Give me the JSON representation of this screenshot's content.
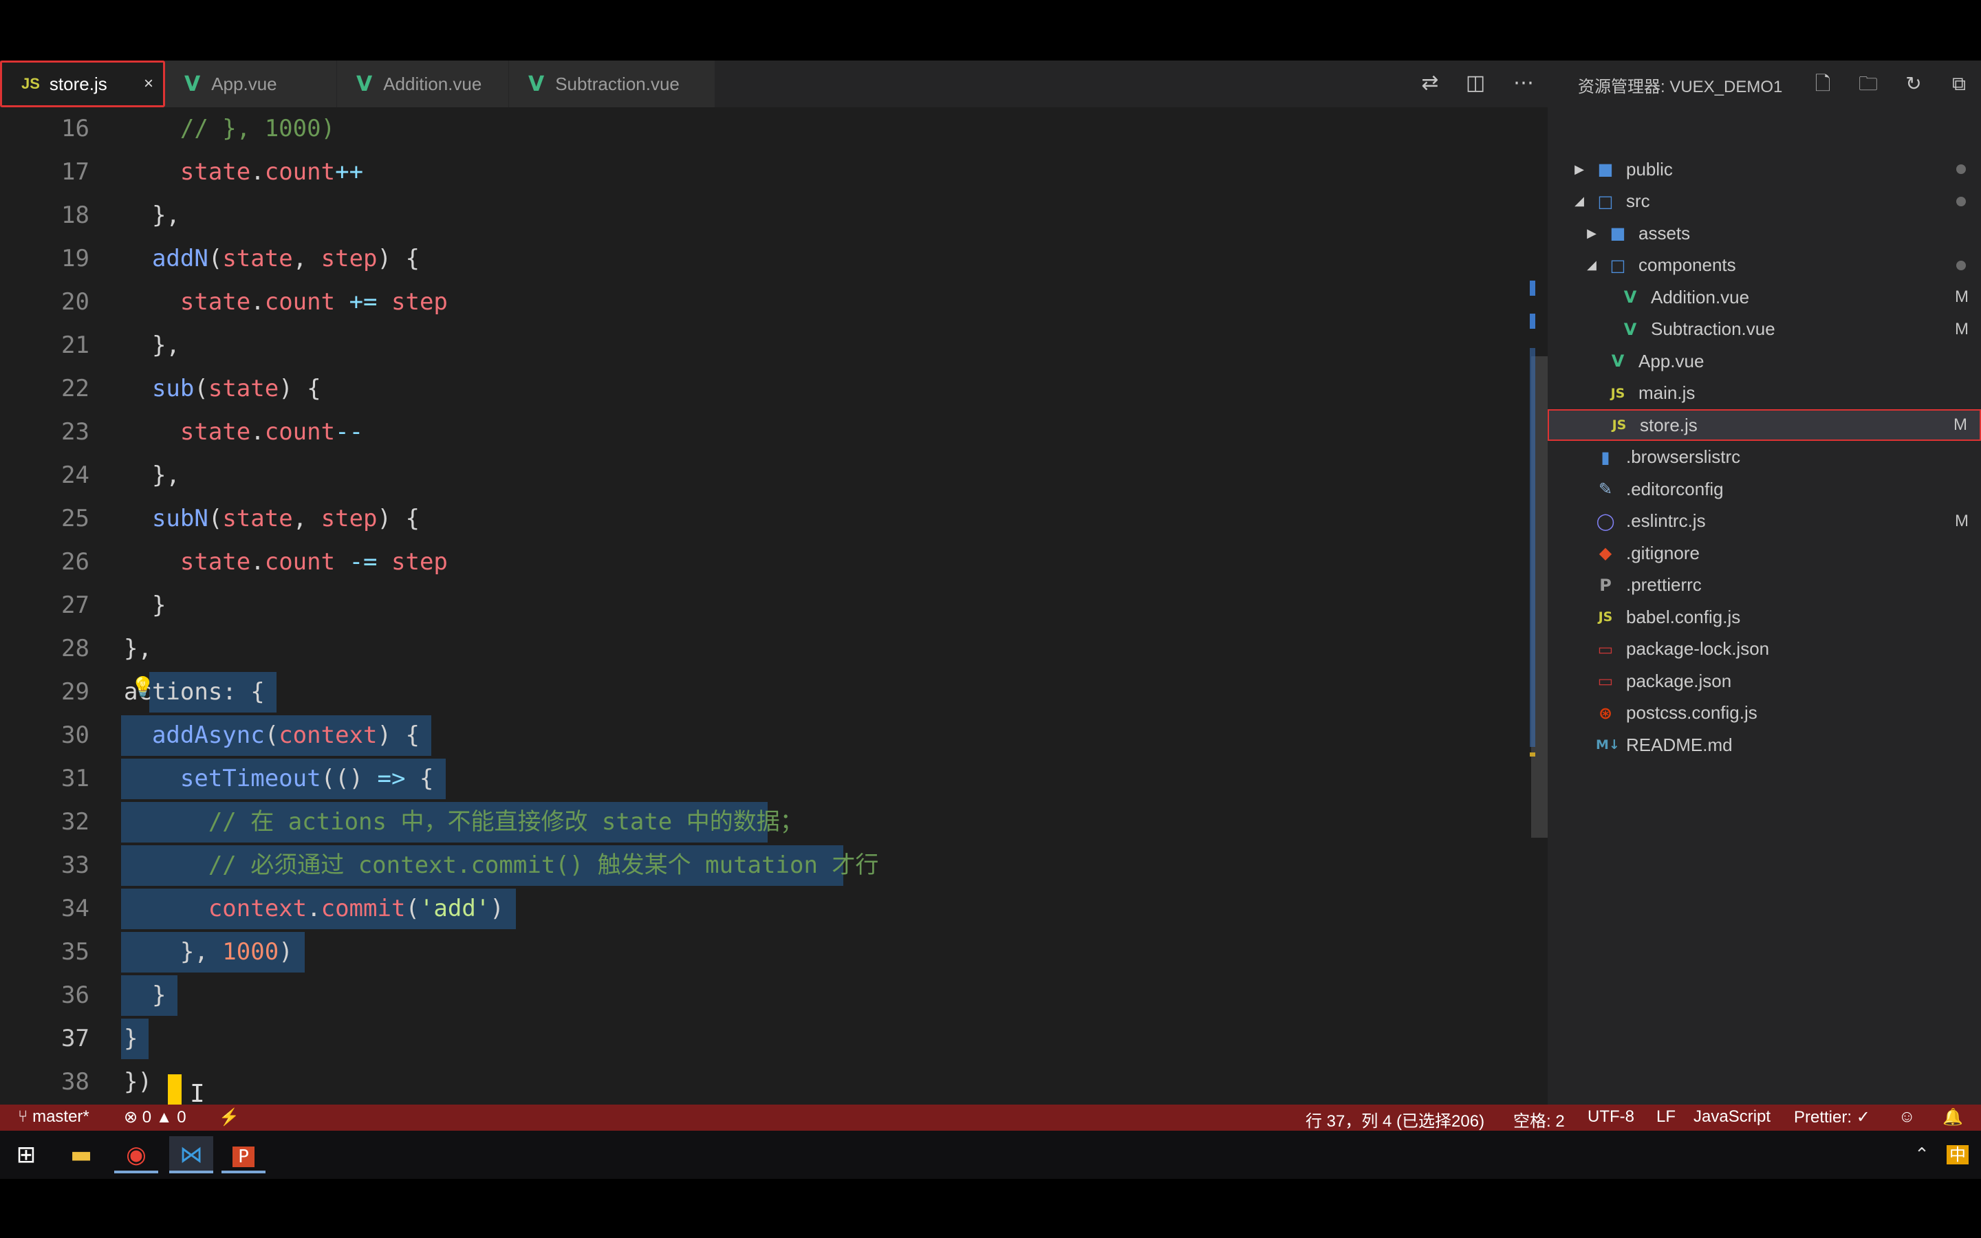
{
  "tabs": [
    {
      "icon": "JS",
      "label": "store.js",
      "close": "×"
    },
    {
      "icon": "V",
      "label": "App.vue"
    },
    {
      "icon": "V",
      "label": "Addition.vue"
    },
    {
      "icon": "V",
      "label": "Subtraction.vue"
    }
  ],
  "editor": {
    "line_numbers": [
      "16",
      "17",
      "18",
      "19",
      "20",
      "21",
      "22",
      "23",
      "24",
      "25",
      "26",
      "27",
      "28",
      "29",
      "30",
      "31",
      "32",
      "33",
      "34",
      "35",
      "36",
      "37",
      "38"
    ],
    "lines": [
      "    // }, 1000)",
      "    state.count++",
      "  },",
      "  addN(state, step) {",
      "    state.count += step",
      "  },",
      "  sub(state) {",
      "    state.count--",
      "  },",
      "  subN(state, step) {",
      "    state.count -= step",
      "  }",
      "},",
      "actions: {",
      "  addAsync(context) {",
      "    setTimeout(() => {",
      "      // 在 actions 中，不能直接修改 state 中的数据；",
      "      // 必须通过 context.commit() 触发某个 mutation 才行",
      "      context.commit('add')",
      "    }, 1000)",
      "  }",
      "}",
      "})"
    ],
    "cursor_line": "37",
    "bulb_icon": "💡"
  },
  "sidebar": {
    "title": "资源管理器: VUEX_DEMO1",
    "items": [
      {
        "name": "public",
        "type": "folder",
        "status": "●"
      },
      {
        "name": "src",
        "type": "folder-open",
        "status": "●"
      },
      {
        "name": "assets",
        "type": "folder"
      },
      {
        "name": "components",
        "type": "folder-open",
        "status": "●"
      },
      {
        "name": "Addition.vue",
        "type": "vue",
        "status": "M"
      },
      {
        "name": "Subtraction.vue",
        "type": "vue",
        "status": "M"
      },
      {
        "name": "App.vue",
        "type": "vue"
      },
      {
        "name": "main.js",
        "type": "js"
      },
      {
        "name": "store.js",
        "type": "js",
        "status": "M",
        "selected": true
      },
      {
        "name": ".browserslistrc",
        "type": "file"
      },
      {
        "name": ".editorconfig",
        "type": "editorconfig"
      },
      {
        "name": ".eslintrc.js",
        "type": "eslint",
        "status": "M"
      },
      {
        "name": ".gitignore",
        "type": "git"
      },
      {
        "name": ".prettierrc",
        "type": "prettier"
      },
      {
        "name": "babel.config.js",
        "type": "js"
      },
      {
        "name": "package-lock.json",
        "type": "npm"
      },
      {
        "name": "package.json",
        "type": "npm"
      },
      {
        "name": "postcss.config.js",
        "type": "postcss"
      },
      {
        "name": "README.md",
        "type": "md"
      }
    ]
  },
  "statusbar": {
    "branch": "master*",
    "errors": "0",
    "warnings": "0",
    "position": "行 37，列 4 (已选择206)",
    "indent": "空格: 2",
    "encoding": "UTF-8",
    "eol": "LF",
    "language": "JavaScript",
    "prettier": "Prettier: ✓"
  },
  "colors": {
    "statusbar": "#7a1c1c",
    "selection": "#264f78",
    "vue": "#41b883",
    "js": "#cbcb41",
    "cursor": "#ffcc00"
  }
}
